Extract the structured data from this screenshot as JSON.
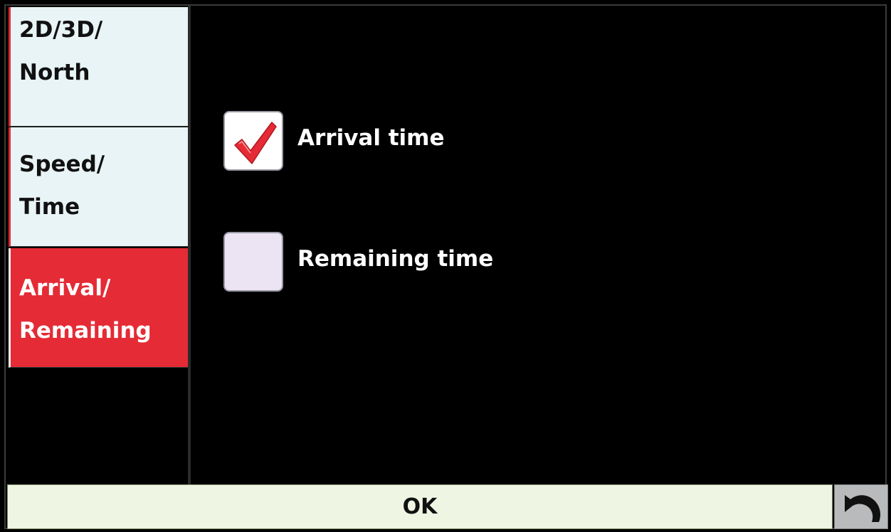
{
  "sidebar": {
    "items": [
      {
        "line1": "2D/3D/",
        "line2": "North",
        "state": "inactive"
      },
      {
        "line1": "Speed/",
        "line2": "Time",
        "state": "inactive"
      },
      {
        "line1": "Arrival/",
        "line2": "Remaining",
        "state": "active"
      }
    ]
  },
  "options": [
    {
      "label": "Arrival time",
      "checked": true
    },
    {
      "label": "Remaining time",
      "checked": false
    }
  ],
  "footer": {
    "ok_label": "OK",
    "back_icon": "undo-arrow-icon"
  },
  "colors": {
    "accent_red": "#e52b35",
    "tab_inactive_bg": "#e8f4f5",
    "footer_bg": "#eef5e2",
    "background": "#000000"
  }
}
